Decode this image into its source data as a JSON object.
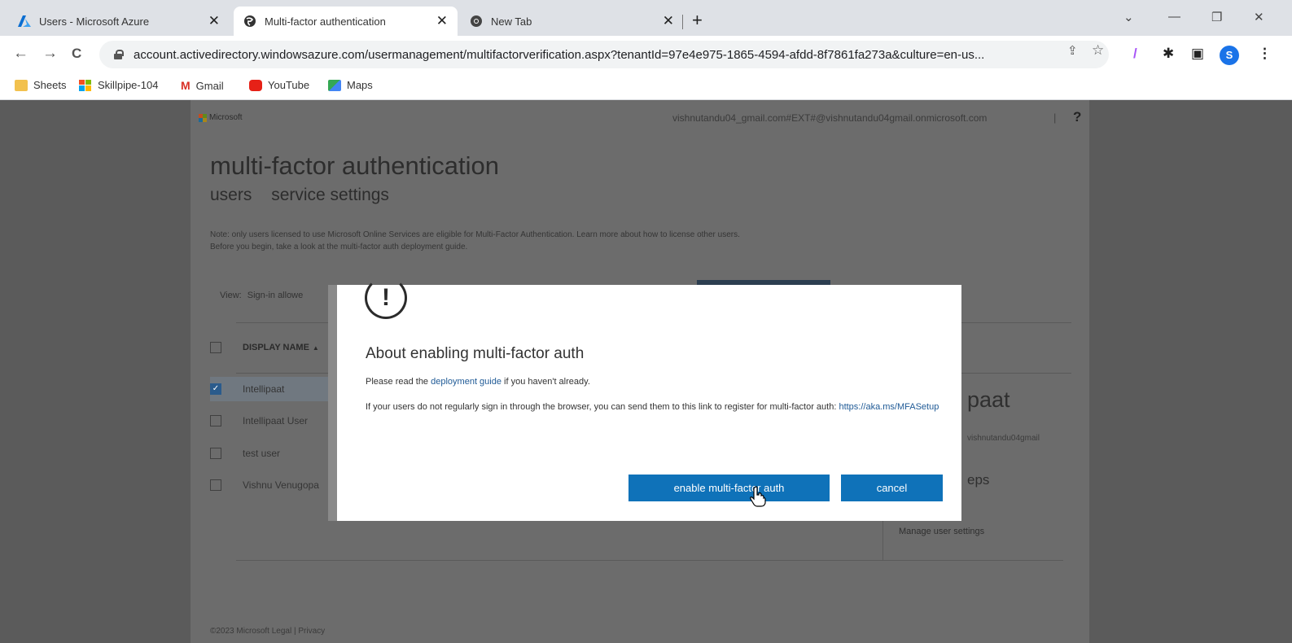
{
  "browser": {
    "tabs": [
      {
        "title": "Users - Microsoft Azure",
        "icon": "azure-icon"
      },
      {
        "title": "Multi-factor authentication",
        "icon": "globe-icon"
      },
      {
        "title": "New Tab",
        "icon": "chrome-icon"
      }
    ],
    "close_glyph": "✕",
    "new_tab_glyph": "+",
    "window_controls": {
      "chevron": "⌄",
      "minimize": "—",
      "restore": "❐",
      "close": "✕"
    },
    "nav": {
      "back": "←",
      "forward": "→",
      "reload": "C"
    },
    "url": "account.activedirectory.windowsazure.com/usermanagement/multifactorverification.aspx?tenantId=97e4e975-1865-4594-afdd-8f7861fa273a&culture=en-us...",
    "omnibox_icons": {
      "share": "⇪",
      "star": "☆"
    },
    "extensions": {
      "feather": "/",
      "puzzle": "✱",
      "sidepanel": "▣",
      "menu": "⋮"
    },
    "profile_initial": "S",
    "bookmarks": [
      {
        "label": "Sheets",
        "icon": "sheets-folder-icon",
        "color": "#f2c14e"
      },
      {
        "label": "Skillpipe-104",
        "icon": "skillpipe-icon",
        "color": "#4285f4"
      },
      {
        "label": "Gmail",
        "icon": "gmail-icon",
        "color": "#d93025"
      },
      {
        "label": "YouTube",
        "icon": "youtube-icon",
        "color": "#e62117"
      },
      {
        "label": "Maps",
        "icon": "maps-icon",
        "color": "#34a853"
      }
    ]
  },
  "page": {
    "brand": "Microsoft",
    "account": "vishnutandu04_gmail.com#EXT#@vishnutandu04gmail.onmicrosoft.com",
    "separator": "|",
    "help": "?",
    "title": "multi-factor authentication",
    "tabs": [
      "users",
      "service settings"
    ],
    "note_line1": "Note: only users licensed to use Microsoft Online Services are eligible for Multi-Factor Authentication. Learn more about how to license other users.",
    "note_line2": "Before you begin, take a look at the multi-factor auth deployment guide.",
    "view_label": "View:",
    "view_value": "Sign-in allowe",
    "column_header": "DISPLAY NAME",
    "sort_glyph": "▲",
    "rows": [
      {
        "name": "Intellipaat",
        "checked": true
      },
      {
        "name": "Intellipaat User",
        "checked": false
      },
      {
        "name": "test user",
        "checked": false
      },
      {
        "name": "Vishnu Venugopa",
        "checked": false
      }
    ],
    "side_name": "paat",
    "side_mail": "vishnutandu04gmail",
    "side_steps": "eps",
    "side_link": "Manage user settings",
    "footer": "©2023 Microsoft    Legal  |  Privacy"
  },
  "modal": {
    "icon_glyph": "!",
    "title": "About enabling multi-factor auth",
    "p1_before": "Please read the ",
    "p1_link": "deployment guide",
    "p1_after": " if you haven't already.",
    "p2_text": "If your users do not regularly sign in through the browser, you can send them to this link to register for multi-factor auth: ",
    "p2_link": "https://aka.ms/MFASetup",
    "enable_label": "enable multi-factor auth",
    "cancel_label": "cancel"
  },
  "colors": {
    "accent": "#0f72b9",
    "link": "#1f5a96",
    "overlay": "#5b5b5b"
  }
}
